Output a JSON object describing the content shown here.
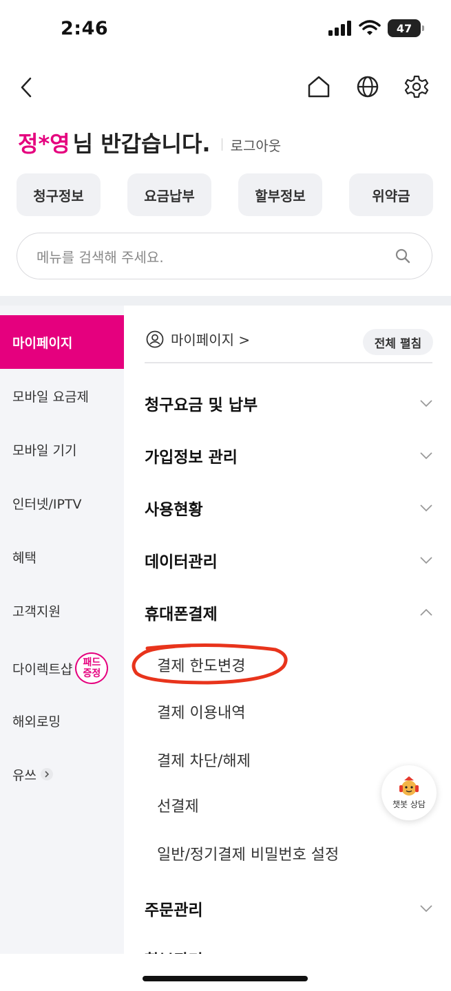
{
  "status": {
    "time": "2:46",
    "battery": "47"
  },
  "greeting": {
    "name": "정*영",
    "rest": "님 반갑습니다.",
    "logout": "로그아웃"
  },
  "quick": [
    "청구정보",
    "요금납부",
    "할부정보",
    "위약금"
  ],
  "search": {
    "placeholder": "메뉴를 검색해 주세요."
  },
  "sidebar": {
    "items": [
      {
        "label": "마이페이지"
      },
      {
        "label": "모바일 요금제"
      },
      {
        "label": "모바일 기기"
      },
      {
        "label": "인터넷/IPTV"
      },
      {
        "label": "혜택"
      },
      {
        "label": "고객지원"
      },
      {
        "label": "다이렉트샵"
      },
      {
        "label": "해외로밍"
      },
      {
        "label": "유쓰"
      }
    ],
    "pad_badge_line1": "패드",
    "pad_badge_line2": "증정"
  },
  "main": {
    "breadcrumb": "마이페이지 >",
    "expand_all": "전체 펼침",
    "sections": [
      {
        "title": "청구요금 및 납부"
      },
      {
        "title": "가입정보 관리"
      },
      {
        "title": "사용현황"
      },
      {
        "title": "데이터관리"
      },
      {
        "title": "휴대폰결제"
      },
      {
        "title": "주문관리"
      }
    ],
    "sub_items": [
      {
        "label": "결제 한도변경"
      },
      {
        "label": "결제 이용내역"
      },
      {
        "label": "결제 차단/해제"
      },
      {
        "label": "선결제"
      },
      {
        "label": "일반/정기결제 비밀번호 설정"
      }
    ],
    "cut_off_title": "할부관리"
  },
  "chatbot": {
    "label": "챗봇 상담"
  },
  "colors": {
    "accent": "#e5007e",
    "highlight_ring": "#e8341c"
  }
}
